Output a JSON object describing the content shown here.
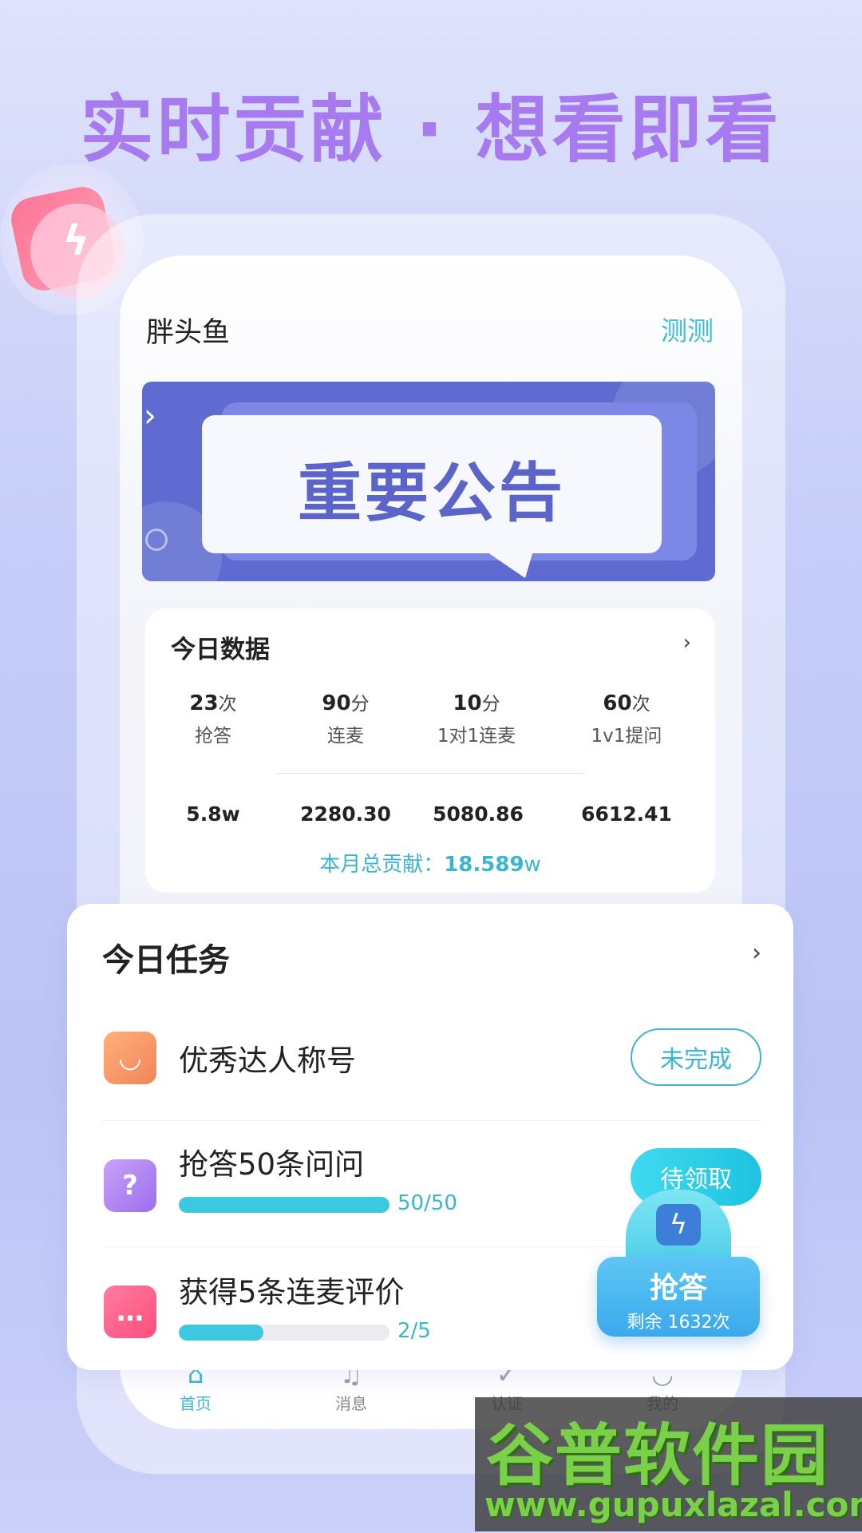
{
  "headline": "实时贡献 · 想看即看",
  "header": {
    "title": "胖头鱼",
    "action": "测测"
  },
  "banner": {
    "text": "重要公告"
  },
  "today_data": {
    "title": "今日数据",
    "stats": [
      {
        "value": "23",
        "unit": "次",
        "label": "抢答"
      },
      {
        "value": "90",
        "unit": "分",
        "label": "连麦"
      },
      {
        "value": "10",
        "unit": "分",
        "label": "1对1连麦"
      },
      {
        "value": "60",
        "unit": "次",
        "label": "1v1提问"
      }
    ],
    "amounts": [
      "5.8w",
      "2280.30",
      "5080.86",
      "6612.41"
    ],
    "total_label": "本月总贡献：",
    "total_value": "18.589",
    "total_unit": "w"
  },
  "tasks": {
    "title": "今日任务",
    "items": [
      {
        "name": "优秀达人称号",
        "button": "未完成",
        "icon": "diamond-icon"
      },
      {
        "name": "抢答50条问问",
        "progress_text": "50/50",
        "progress": 1.0,
        "button": "待领取",
        "icon": "question-icon"
      },
      {
        "name": "获得5条连麦评价",
        "progress_text": "2/5",
        "progress": 0.4,
        "icon": "chat-bubble-icon"
      }
    ]
  },
  "fab": {
    "label": "抢答",
    "sub": "剩余 1632次"
  },
  "tabs": [
    {
      "label": "首页",
      "icon": "home-icon",
      "active": true
    },
    {
      "label": "消息",
      "icon": "bell-icon"
    },
    {
      "label": "认证",
      "icon": "verified-icon"
    },
    {
      "label": "我的",
      "icon": "user-icon"
    }
  ],
  "watermark": {
    "title": "谷普软件园",
    "url": "www.gupuxlazal.com"
  },
  "colors": {
    "accent": "#3bb6ce",
    "headline": "#a77af0",
    "banner": "#5f6bd0"
  }
}
